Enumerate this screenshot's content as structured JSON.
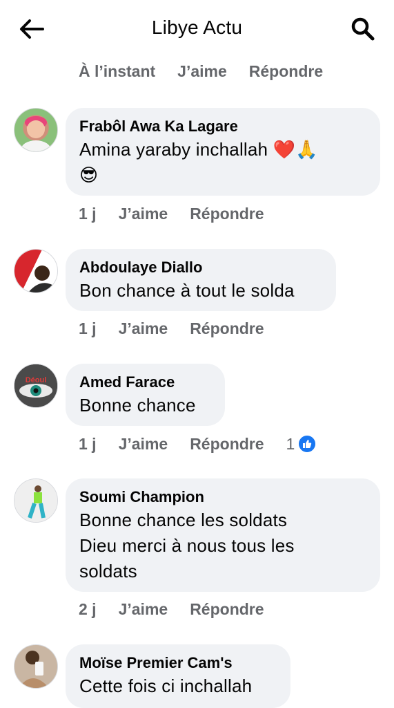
{
  "header": {
    "title": "Libye Actu",
    "back_icon": "arrow-left-icon",
    "search_icon": "search-icon"
  },
  "top_actions": {
    "time": "À l’instant",
    "like": "J’aime",
    "reply": "Répondre"
  },
  "comments": [
    {
      "author": "Frabôl Awa Ka Lagare",
      "text": "Amina yaraby inchallah ❤️🙏\n😎",
      "time": "1 j",
      "like": "J’aime",
      "reply": "Répondre"
    },
    {
      "author": "Abdoulaye Diallo",
      "text": "Bon chance à tout le solda",
      "time": "1 j",
      "like": "J’aime",
      "reply": "Répondre"
    },
    {
      "author": "Amed Farace",
      "text": "Bonne chance",
      "time": "1 j",
      "like": "J’aime",
      "reply": "Répondre",
      "reactions": "1",
      "avatar_text": "Déoul"
    },
    {
      "author": "Soumi Champion",
      "text": "Bonne chance les soldats\nDieu merci à nous tous les\nsoldats",
      "time": "2 j",
      "like": "J’aime",
      "reply": "Répondre"
    },
    {
      "author": "Moïse Premier Cam's",
      "text": "Cette fois ci inchallah"
    }
  ],
  "colors": {
    "bubble": "#f0f2f5",
    "meta_text": "#65676b",
    "like_blue": "#1877f2"
  }
}
